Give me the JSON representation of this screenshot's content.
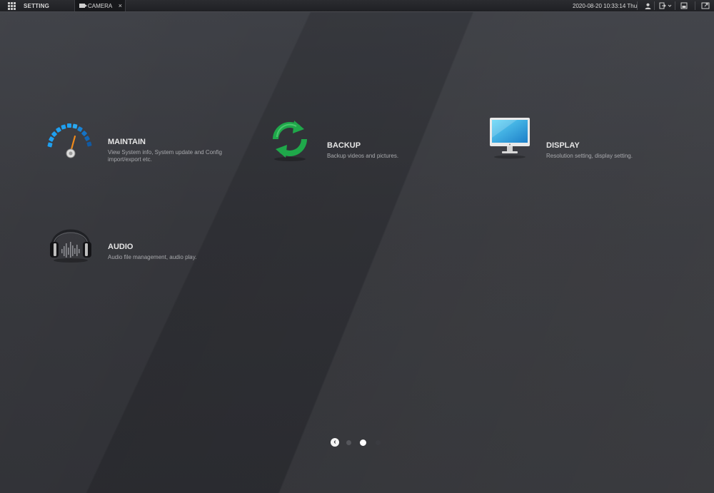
{
  "topbar": {
    "setting_label": "SETTING",
    "camera_tab_label": "CAMERA",
    "close_glyph": "×",
    "datetime": "2020-08-20 10:33:14 Thu"
  },
  "tiles": [
    {
      "icon": "gauge-icon",
      "title": "MAINTAIN",
      "desc": "View System info, System update and Config import/export etc."
    },
    {
      "icon": "refresh-arrows-icon",
      "title": "BACKUP",
      "desc": "Backup videos and pictures."
    },
    {
      "icon": "monitor-icon",
      "title": "DISPLAY",
      "desc": "Resolution setting, display setting."
    },
    {
      "icon": "headphones-icon",
      "title": "AUDIO",
      "desc": "Audio file management, audio play."
    }
  ],
  "pager": {
    "prev_glyph": "‹",
    "page_count": 3,
    "current_page": 2
  },
  "colors": {
    "background": "#2e2f34",
    "topbar": "#1f2024",
    "backup_green": "#1fa84a",
    "gauge_blue": "#1fa0f0",
    "needle_orange": "#f08a1c"
  }
}
